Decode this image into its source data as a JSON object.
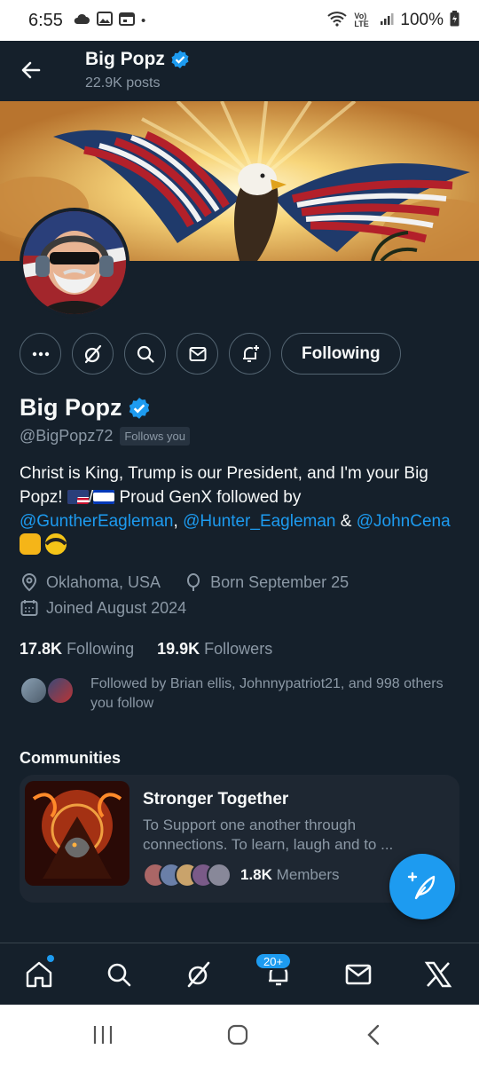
{
  "status_bar": {
    "time": "6:55",
    "battery": "100%",
    "network": "Vo) LTE",
    "dot": "•"
  },
  "header": {
    "name": "Big Popz",
    "posts": "22.9K posts"
  },
  "profile": {
    "name": "Big Popz",
    "handle": "@BigPopz72",
    "follows_you": "Follows you",
    "bio_text_1": "Christ is King, Trump is our President, and I'm your Big Popz!",
    "bio_sep": "/",
    "bio_text_2": "Proud GenX followed by",
    "mention_1": "@GuntherEagleman",
    "comma": ",",
    "mention_2": "@Hunter_Eagleman",
    "amp": "&",
    "mention_3": "@JohnCena",
    "location": "Oklahoma, USA",
    "birthday": "Born September 25",
    "joined": "Joined August 2024",
    "following_count": "17.8K",
    "following_label": "Following",
    "followers_count": "19.9K",
    "followers_label": "Followers",
    "followed_by": "Followed by Brian ellis, Johnnypatriot21, and 998 others you follow"
  },
  "actions": {
    "following_button": "Following"
  },
  "communities": {
    "section_title": "Communities",
    "items": [
      {
        "title": "Stronger Together",
        "description": "To Support one another through connections. To learn, laugh and to ...",
        "members_count": "1.8K",
        "members_label": "Members"
      }
    ]
  },
  "tabbar": {
    "notifications_badge": "20+"
  },
  "colors": {
    "background": "#15202b",
    "accent": "#1d9bf0",
    "muted": "#8b98a5"
  }
}
